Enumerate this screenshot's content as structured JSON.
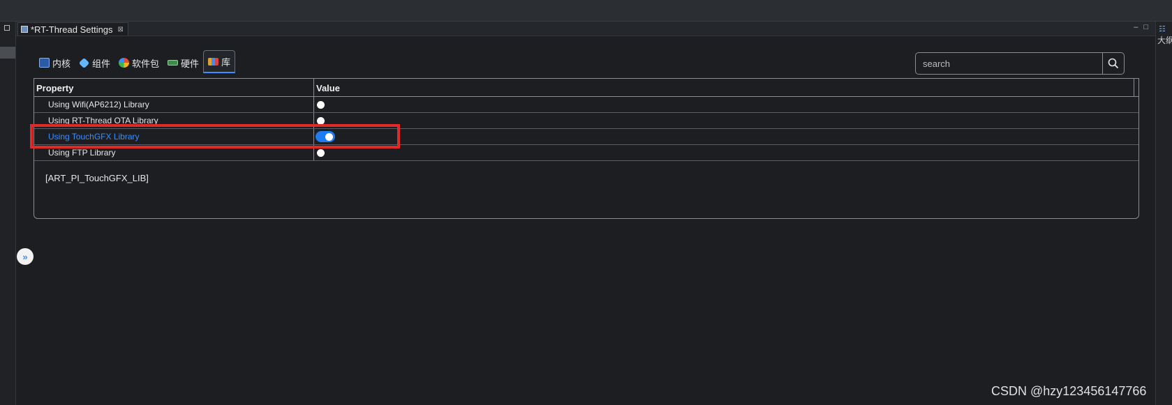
{
  "window": {
    "tab_title": "*RT-Thread Settings",
    "tab_close": "⊠",
    "controls": [
      "–",
      "□"
    ]
  },
  "right_panel": {
    "label": "大纲",
    "icon": "outline-icon"
  },
  "category_tabs": [
    {
      "label": "内核",
      "icon": "kernel-icon",
      "active": false
    },
    {
      "label": "组件",
      "icon": "component-icon",
      "active": false
    },
    {
      "label": "软件包",
      "icon": "package-icon",
      "active": false
    },
    {
      "label": "硬件",
      "icon": "hardware-icon",
      "active": false
    },
    {
      "label": "库",
      "icon": "library-icon",
      "active": true
    }
  ],
  "search": {
    "placeholder": "search",
    "value": ""
  },
  "table": {
    "headers": [
      "Property",
      "Value"
    ],
    "rows": [
      {
        "property": "Using Wifi(AP6212) Library",
        "enabled": false,
        "selected": false
      },
      {
        "property": "Using RT-Thread OTA Library",
        "enabled": false,
        "selected": false
      },
      {
        "property": "Using TouchGFX Library",
        "enabled": true,
        "selected": true
      },
      {
        "property": "Using FTP Library",
        "enabled": false,
        "selected": false
      }
    ]
  },
  "description": "[ART_PI_TouchGFX_LIB]",
  "expand_button": "»",
  "watermark": "CSDN @hzy123456147766",
  "colors": {
    "accent": "#3c8dff",
    "highlight": "#e02a2a",
    "background": "#1c1e21"
  }
}
